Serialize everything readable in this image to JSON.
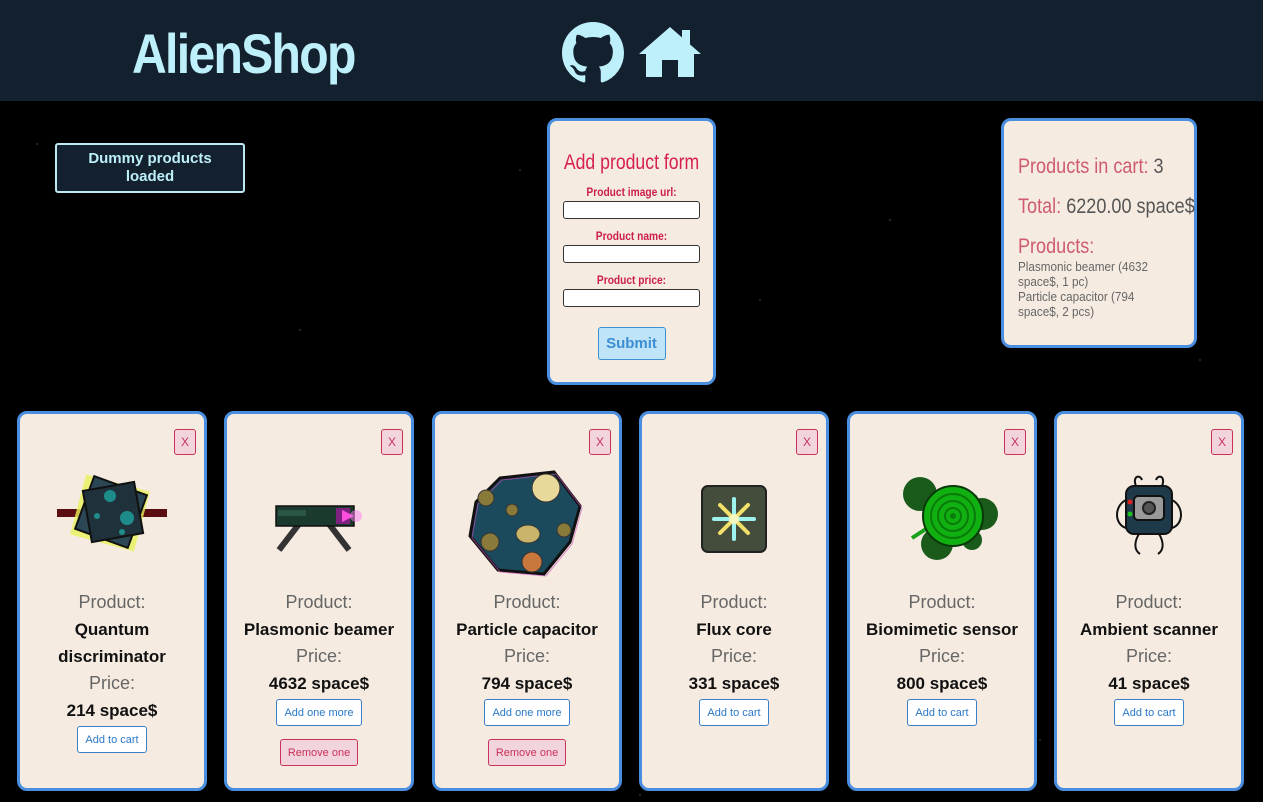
{
  "header": {
    "logo": "AlienShop",
    "github_icon": "github-icon",
    "home_icon": "home-icon"
  },
  "status": {
    "message": "Dummy products loaded"
  },
  "form": {
    "title": "Add product form",
    "image_label": "Product image url:",
    "name_label": "Product name:",
    "price_label": "Product price:",
    "image_value": "",
    "name_value": "",
    "price_value": "",
    "submit": "Submit"
  },
  "cart": {
    "count_label": "Products in cart:",
    "count_value": "3",
    "total_label": "Total:",
    "total_value": "6220.00 space$",
    "products_label": "Products:",
    "items": [
      "Plasmonic beamer (4632 space$, 1 pc)",
      "Particle capacitor (794 space$, 2 pcs)"
    ]
  },
  "products": [
    {
      "product_label": "Product:",
      "name": "Quantum discriminator",
      "price_label": "Price:",
      "price": "214 space$",
      "add": "Add to cart",
      "remove": "",
      "close": "X",
      "icon": "quantum-discriminator-icon"
    },
    {
      "product_label": "Product:",
      "name": "Plasmonic beamer",
      "price_label": "Price:",
      "price": "4632 space$",
      "add": "Add one more",
      "remove": "Remove one",
      "close": "X",
      "icon": "plasmonic-beamer-icon"
    },
    {
      "product_label": "Product:",
      "name": "Particle capacitor",
      "price_label": "Price:",
      "price": "794 space$",
      "add": "Add one more",
      "remove": "Remove one",
      "close": "X",
      "icon": "particle-capacitor-icon"
    },
    {
      "product_label": "Product:",
      "name": "Flux core",
      "price_label": "Price:",
      "price": "331 space$",
      "add": "Add to cart",
      "remove": "",
      "close": "X",
      "icon": "flux-core-icon"
    },
    {
      "product_label": "Product:",
      "name": "Biomimetic sensor",
      "price_label": "Price:",
      "price": "800 space$",
      "add": "Add to cart",
      "remove": "",
      "close": "X",
      "icon": "biomimetic-sensor-icon"
    },
    {
      "product_label": "Product:",
      "name": "Ambient scanner",
      "price_label": "Price:",
      "price": "41 space$",
      "add": "Add to cart",
      "remove": "",
      "close": "X",
      "icon": "ambient-scanner-icon"
    }
  ]
}
